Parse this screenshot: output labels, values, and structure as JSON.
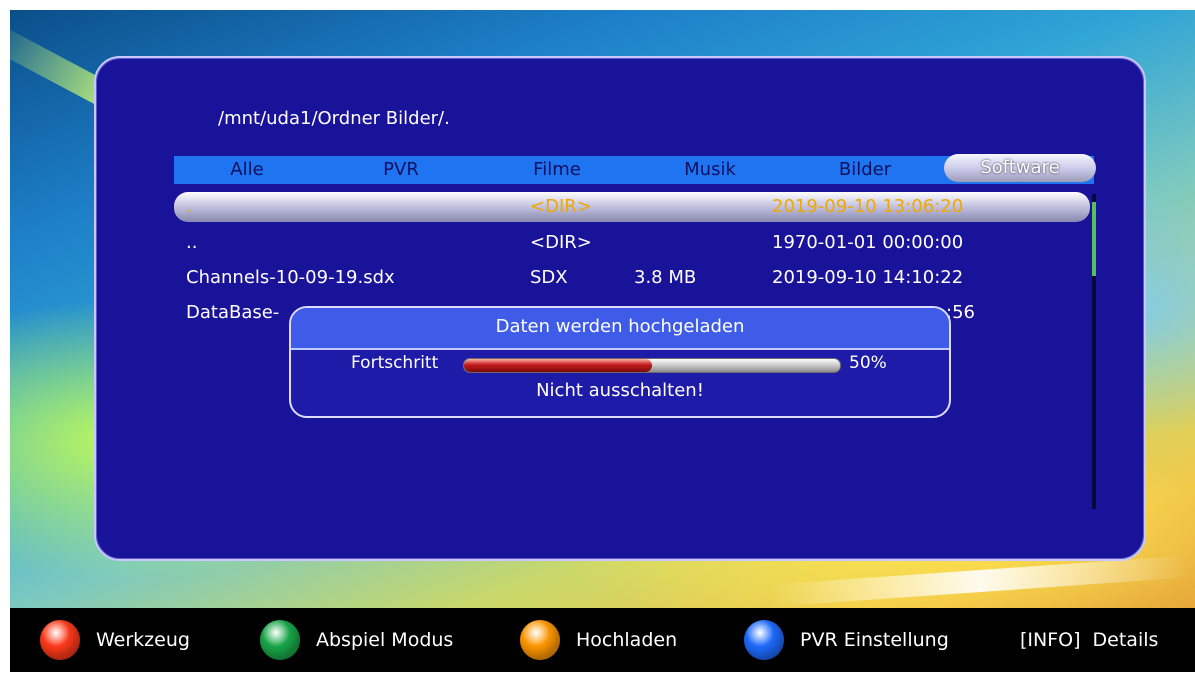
{
  "path": "/mnt/uda1/Ordner Bilder/.",
  "tabs": [
    "Alle",
    "PVR",
    "Filme",
    "Musik",
    "Bilder",
    "Software"
  ],
  "active_tab_index": 5,
  "files": [
    {
      "name": ".",
      "type": "<DIR>",
      "size": "",
      "date": "2019-09-10 13:06:20"
    },
    {
      "name": "..",
      "type": "<DIR>",
      "size": "",
      "date": "1970-01-01 00:00:00"
    },
    {
      "name": "Channels-10-09-19.sdx",
      "type": "SDX",
      "size": "3.8 MB",
      "date": "2019-09-10 14:10:22"
    },
    {
      "name": "DataBase-",
      "type": "",
      "size": "",
      "date": ":56"
    }
  ],
  "selected_row_index": 0,
  "dialog": {
    "title": "Daten werden hochgeladen",
    "progress_label": "Fortschritt",
    "progress_value": 50,
    "progress_text": "50%",
    "message": "Nicht ausschalten!"
  },
  "legend": [
    {
      "color": "#ff3a1a",
      "label": "Werkzeug"
    },
    {
      "color": "#19a84a",
      "label": "Abspiel Modus"
    },
    {
      "color": "#ff9800",
      "label": "Hochladen"
    },
    {
      "color": "#1e6cff",
      "label": "PVR Einstellung"
    }
  ],
  "info_key": "[INFO]",
  "info_label": "Details"
}
